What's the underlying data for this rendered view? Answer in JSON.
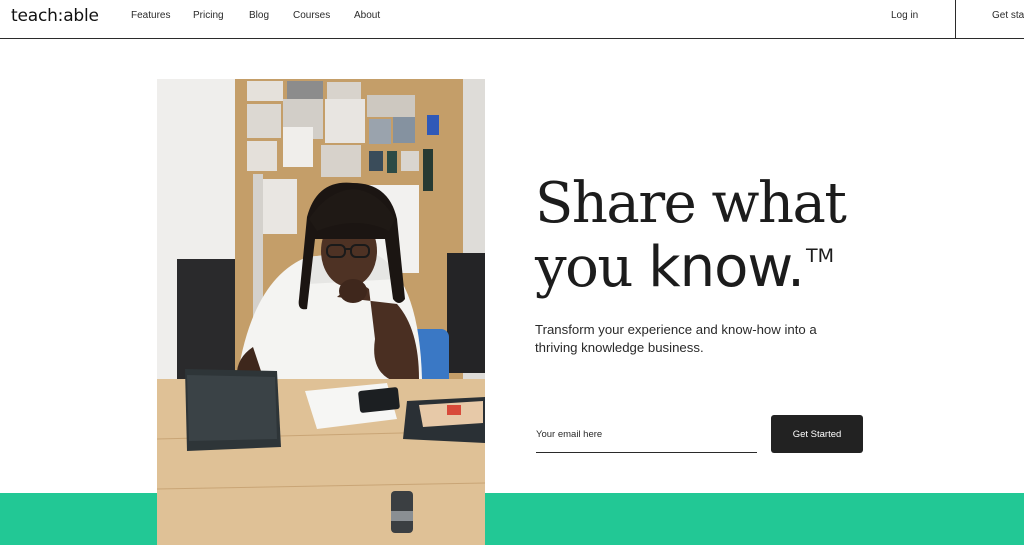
{
  "nav": {
    "logo": "teach:able",
    "links": [
      "Features",
      "Pricing",
      "Blog",
      "Courses",
      "About"
    ],
    "login": "Log in",
    "get_started": "Get sta"
  },
  "hero": {
    "headline_line1": "Share what",
    "headline_line2_light": "you",
    "headline_line2_bold": "know.",
    "trademark": "TM",
    "subheading": "Transform your experience and know-how into a thriving knowledge business.",
    "email_placeholder": "Your email here",
    "cta_label": "Get Started"
  },
  "colors": {
    "accent_green": "#22c895",
    "button_dark": "#222222"
  }
}
